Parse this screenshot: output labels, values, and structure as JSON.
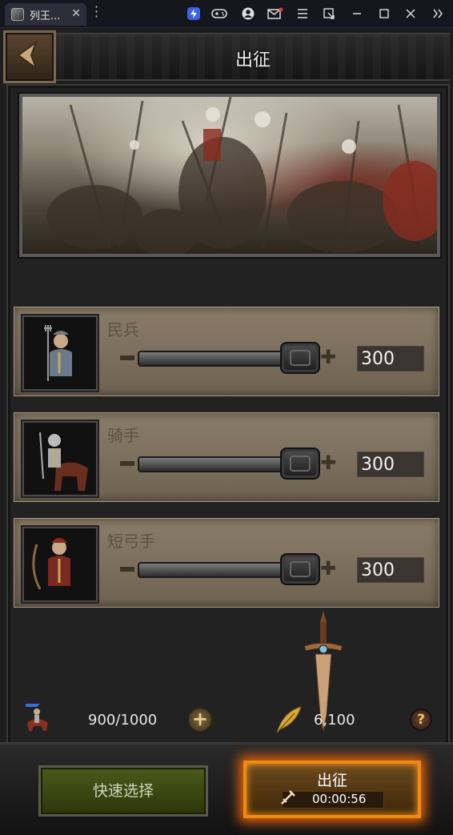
{
  "browser": {
    "tab_title": "列王...",
    "tab_close": "✕",
    "toolbar_icons": [
      "lightning-icon",
      "gamepad-icon",
      "avatar-icon",
      "mail-icon",
      "menu-icon",
      "popout-icon",
      "minimize-icon",
      "maximize-icon",
      "close-icon",
      "sidebar-expand-icon"
    ]
  },
  "header": {
    "title": "出征"
  },
  "troops": [
    {
      "name": "民兵",
      "count": "300",
      "fraction": 1.0
    },
    {
      "name": "骑手",
      "count": "300",
      "fraction": 1.0
    },
    {
      "name": "短弓手",
      "count": "300",
      "fraction": 1.0
    }
  ],
  "stats": {
    "troop_capacity": "900/1000",
    "gold": "6,100"
  },
  "footer": {
    "quick_select_label": "快速选择",
    "march_label": "出征",
    "march_timer": "00:00:56"
  },
  "colors": {
    "march_glow": "#f08a12",
    "quick_button": "#4c5a1a",
    "card_bg": "#8a7c68"
  }
}
